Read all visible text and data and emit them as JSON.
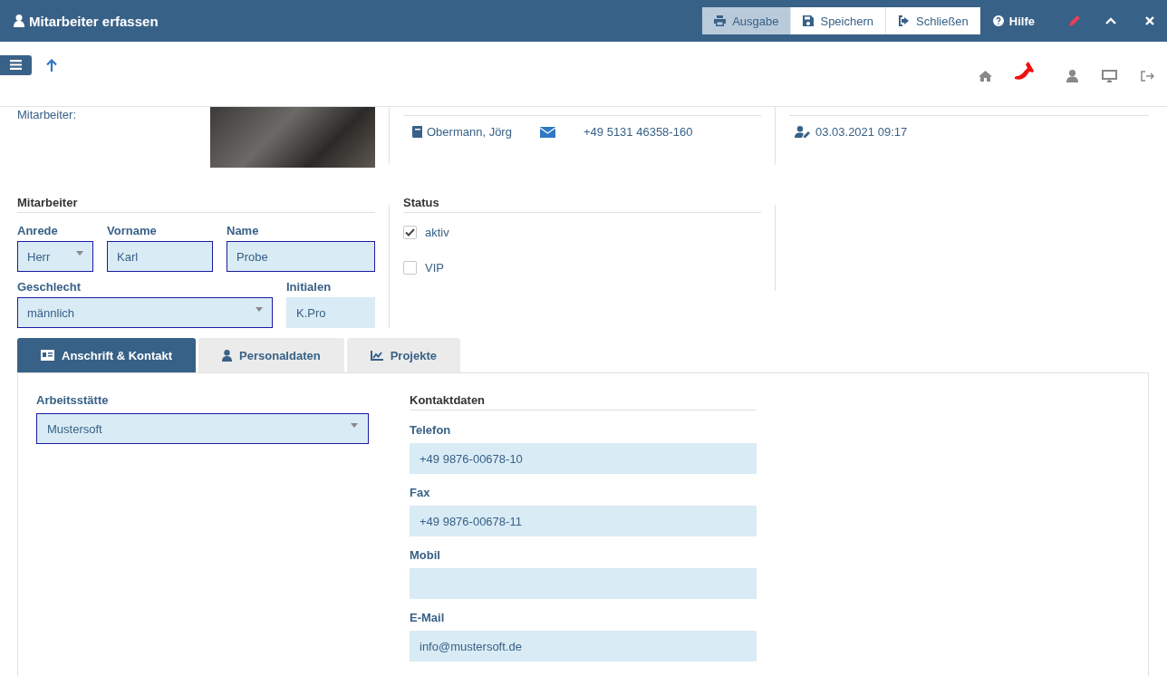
{
  "window": {
    "title": "Mitarbeiter erfassen"
  },
  "header_buttons": [
    {
      "label": "Ausgabe",
      "pressed": true,
      "kind": "print"
    },
    {
      "label": "Speichern",
      "pressed": false,
      "kind": "save"
    },
    {
      "label": "Schließen",
      "pressed": false,
      "kind": "exit"
    }
  ],
  "help": {
    "label": "Hilfe"
  },
  "summary": {
    "caption": "Mitarbeiter:",
    "contact_name": "Obermann, Jörg",
    "contact_phone": "+49 5131 46358-160",
    "modified": "03.03.2021 09:17"
  },
  "employee": {
    "title": "Mitarbeiter",
    "fields": [
      {
        "label": "Anrede",
        "value": "Herr",
        "kind": "select",
        "editable": true
      },
      {
        "label": "Vorname",
        "value": "Karl",
        "kind": "text",
        "editable": true
      },
      {
        "label": "Name",
        "value": "Probe",
        "kind": "text",
        "editable": true
      },
      {
        "label": "Geschlecht",
        "value": "männlich",
        "kind": "select",
        "editable": true
      },
      {
        "label": "Initialen",
        "value": "K.Pro",
        "kind": "text",
        "editable": false
      }
    ]
  },
  "status": {
    "title": "Status",
    "options": [
      {
        "label": "aktiv",
        "checked": true
      },
      {
        "label": "VIP",
        "checked": false
      }
    ]
  },
  "tabs": [
    {
      "label": "Anschrift & Kontakt",
      "selected": true,
      "kind": "address"
    },
    {
      "label": "Personaldaten",
      "selected": false,
      "kind": "personal"
    },
    {
      "label": "Projekte",
      "selected": false,
      "kind": "projects"
    }
  ],
  "workplace": {
    "label": "Arbeitsstätte",
    "value": "Mustersoft"
  },
  "contact": {
    "title": "Kontaktdaten",
    "fields": [
      {
        "label": "Telefon",
        "value": "+49 9876-00678-10"
      },
      {
        "label": "Fax",
        "value": "+49 9876-00678-11"
      },
      {
        "label": "Mobil"
      },
      {
        "label": "E-Mail",
        "value": "info@mustersoft.de"
      }
    ]
  }
}
